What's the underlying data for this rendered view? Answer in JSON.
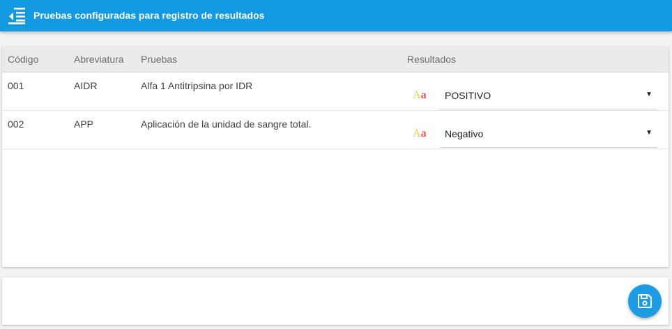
{
  "header": {
    "title": "Pruebas configuradas para registro de resultados",
    "menu_icon": "menu-collapse-icon"
  },
  "table": {
    "columns": {
      "codigo": "Código",
      "abreviatura": "Abreviatura",
      "pruebas": "Pruebas",
      "resultados": "Resultados"
    },
    "rows": [
      {
        "codigo": "001",
        "abreviatura": "AIDR",
        "prueba": "Alfa 1 Antitripsina por IDR",
        "result_type_icon": "text-type-icon",
        "resultado": "POSITIVO"
      },
      {
        "codigo": "002",
        "abreviatura": "APP",
        "prueba": "Aplicación de la unidad de sangre total.",
        "result_type_icon": "text-type-icon",
        "resultado": "Negativo"
      }
    ]
  },
  "text_icon": {
    "upper": "A",
    "lower": "a"
  },
  "footer": {
    "save_icon": "save-icon"
  },
  "colors": {
    "primary": "#1399e2",
    "fab": "#1d9be3",
    "icon_upper": "#f4c63d",
    "icon_lower": "#ec4e5a"
  }
}
